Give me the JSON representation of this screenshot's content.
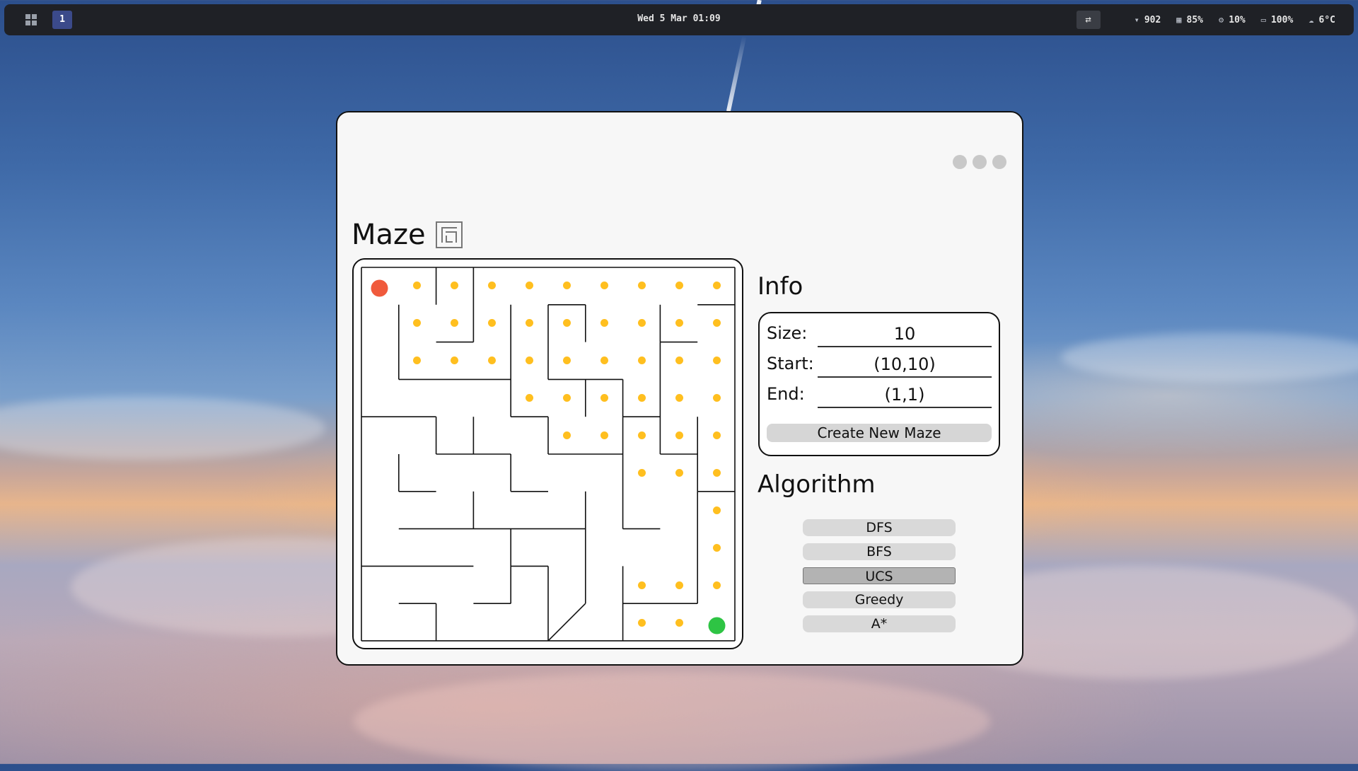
{
  "taskbar": {
    "workspace": "1",
    "clock": "Wed 5 Mar 01:09",
    "swap_icon": "swap-icon",
    "stats": [
      {
        "icon": "wifi-icon",
        "glyph": "▾",
        "value": "902"
      },
      {
        "icon": "memory-icon",
        "glyph": "▦",
        "value": "85%"
      },
      {
        "icon": "cpu-icon",
        "glyph": "⚙",
        "value": "10%"
      },
      {
        "icon": "battery-icon",
        "glyph": "▭",
        "value": "100%"
      },
      {
        "icon": "weather-icon",
        "glyph": "☁",
        "value": "6°C"
      }
    ]
  },
  "window": {
    "title": "Maze",
    "info": {
      "title": "Info",
      "size_label": "Size:",
      "size_value": "10",
      "start_label": "Start:",
      "start_value": "(10,10)",
      "end_label": "End:",
      "end_value": "(1,1)",
      "create_button": "Create New Maze"
    },
    "algorithm": {
      "title": "Algorithm",
      "options": [
        "DFS",
        "BFS",
        "UCS",
        "Greedy",
        "A*"
      ],
      "selected": "UCS"
    }
  },
  "maze": {
    "size": 10,
    "start_color": "#f05a3c",
    "end_color": "#2ec444",
    "path_color": "#ffbf1f",
    "walls": [
      [
        0,
        0,
        10,
        0
      ],
      [
        0,
        10,
        10,
        10
      ],
      [
        0,
        0,
        0,
        10
      ],
      [
        10,
        0,
        10,
        10
      ],
      [
        2,
        0,
        2,
        1
      ],
      [
        3,
        0,
        3,
        2
      ],
      [
        9,
        1,
        10,
        1
      ],
      [
        1,
        1,
        1,
        3
      ],
      [
        2,
        2,
        3,
        2
      ],
      [
        4,
        1,
        4,
        4
      ],
      [
        5,
        1,
        6,
        1
      ],
      [
        5,
        1,
        5,
        3
      ],
      [
        6,
        1,
        6,
        2
      ],
      [
        8,
        1,
        8,
        2
      ],
      [
        8,
        2,
        9,
        2
      ],
      [
        1,
        3,
        4,
        3
      ],
      [
        5,
        3,
        7,
        3
      ],
      [
        6,
        3,
        6,
        4
      ],
      [
        8,
        2,
        8,
        5
      ],
      [
        0,
        4,
        2,
        4
      ],
      [
        2,
        4,
        2,
        5
      ],
      [
        3,
        4,
        3,
        5
      ],
      [
        4,
        4,
        5,
        4
      ],
      [
        5,
        4,
        5,
        5
      ],
      [
        7,
        3,
        7,
        4
      ],
      [
        7,
        4,
        8,
        4
      ],
      [
        8,
        5,
        9,
        5
      ],
      [
        1,
        5,
        1,
        6
      ],
      [
        1,
        6,
        2,
        6
      ],
      [
        2,
        5,
        4,
        5
      ],
      [
        4,
        5,
        4,
        6
      ],
      [
        4,
        6,
        5,
        6
      ],
      [
        5,
        5,
        7,
        5
      ],
      [
        7,
        4,
        7,
        7
      ],
      [
        9,
        4,
        9,
        6
      ],
      [
        3,
        6,
        3,
        7
      ],
      [
        1,
        7,
        6,
        7
      ],
      [
        6,
        6,
        6,
        9
      ],
      [
        7,
        7,
        8,
        7
      ],
      [
        9,
        6,
        10,
        6
      ],
      [
        9,
        6,
        9,
        9
      ],
      [
        4,
        7,
        4,
        9
      ],
      [
        0,
        8,
        3,
        8
      ],
      [
        4,
        8,
        5,
        8
      ],
      [
        3,
        9,
        4,
        9
      ],
      [
        7,
        8,
        7,
        10
      ],
      [
        7,
        9,
        9,
        9
      ],
      [
        1,
        9,
        2,
        9
      ],
      [
        2,
        9,
        2,
        10
      ],
      [
        5,
        8,
        5,
        10
      ],
      [
        6,
        9,
        5,
        10
      ]
    ],
    "path": [
      [
        0,
        0
      ],
      [
        1,
        0
      ],
      [
        2,
        0
      ],
      [
        3,
        0
      ],
      [
        4,
        0
      ],
      [
        5,
        0
      ],
      [
        6,
        0
      ],
      [
        7,
        0
      ],
      [
        8,
        0
      ],
      [
        9,
        0
      ],
      [
        1,
        1
      ],
      [
        2,
        1
      ],
      [
        3,
        1
      ],
      [
        4,
        1
      ],
      [
        5,
        1
      ],
      [
        6,
        1
      ],
      [
        7,
        1
      ],
      [
        8,
        1
      ],
      [
        9,
        1
      ],
      [
        1,
        2
      ],
      [
        2,
        2
      ],
      [
        3,
        2
      ],
      [
        4,
        2
      ],
      [
        5,
        2
      ],
      [
        6,
        2
      ],
      [
        7,
        2
      ],
      [
        8,
        2
      ],
      [
        9,
        2
      ],
      [
        4,
        3
      ],
      [
        5,
        3
      ],
      [
        6,
        3
      ],
      [
        7,
        3
      ],
      [
        8,
        3
      ],
      [
        9,
        3
      ],
      [
        5,
        4
      ],
      [
        6,
        4
      ],
      [
        7,
        4
      ],
      [
        8,
        4
      ],
      [
        9,
        4
      ],
      [
        7,
        5
      ],
      [
        8,
        5
      ],
      [
        9,
        5
      ],
      [
        9,
        6
      ],
      [
        9,
        7
      ],
      [
        7,
        8
      ],
      [
        8,
        8
      ],
      [
        9,
        8
      ],
      [
        7,
        9
      ],
      [
        8,
        9
      ],
      [
        9,
        9
      ]
    ]
  }
}
